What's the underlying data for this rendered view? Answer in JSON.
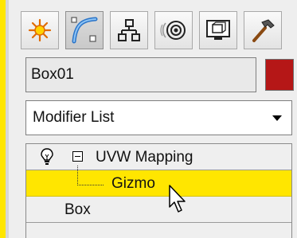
{
  "tabs": [
    {
      "icon": "create-sun-icon",
      "active": false
    },
    {
      "icon": "modify-curve-icon",
      "active": true
    },
    {
      "icon": "hierarchy-icon",
      "active": false
    },
    {
      "icon": "motion-icon",
      "active": false
    },
    {
      "icon": "display-icon",
      "active": false
    },
    {
      "icon": "utilities-hammer-icon",
      "active": false
    }
  ],
  "object": {
    "name": "Box01",
    "color": "#b51717"
  },
  "modifier_list": {
    "selected": "Modifier List"
  },
  "stack": {
    "uvw_label": "UVW Mapping",
    "gizmo_label": "Gizmo",
    "box_label": "Box"
  },
  "colors": {
    "highlight": "#ffe600",
    "swatch": "#b51717"
  }
}
